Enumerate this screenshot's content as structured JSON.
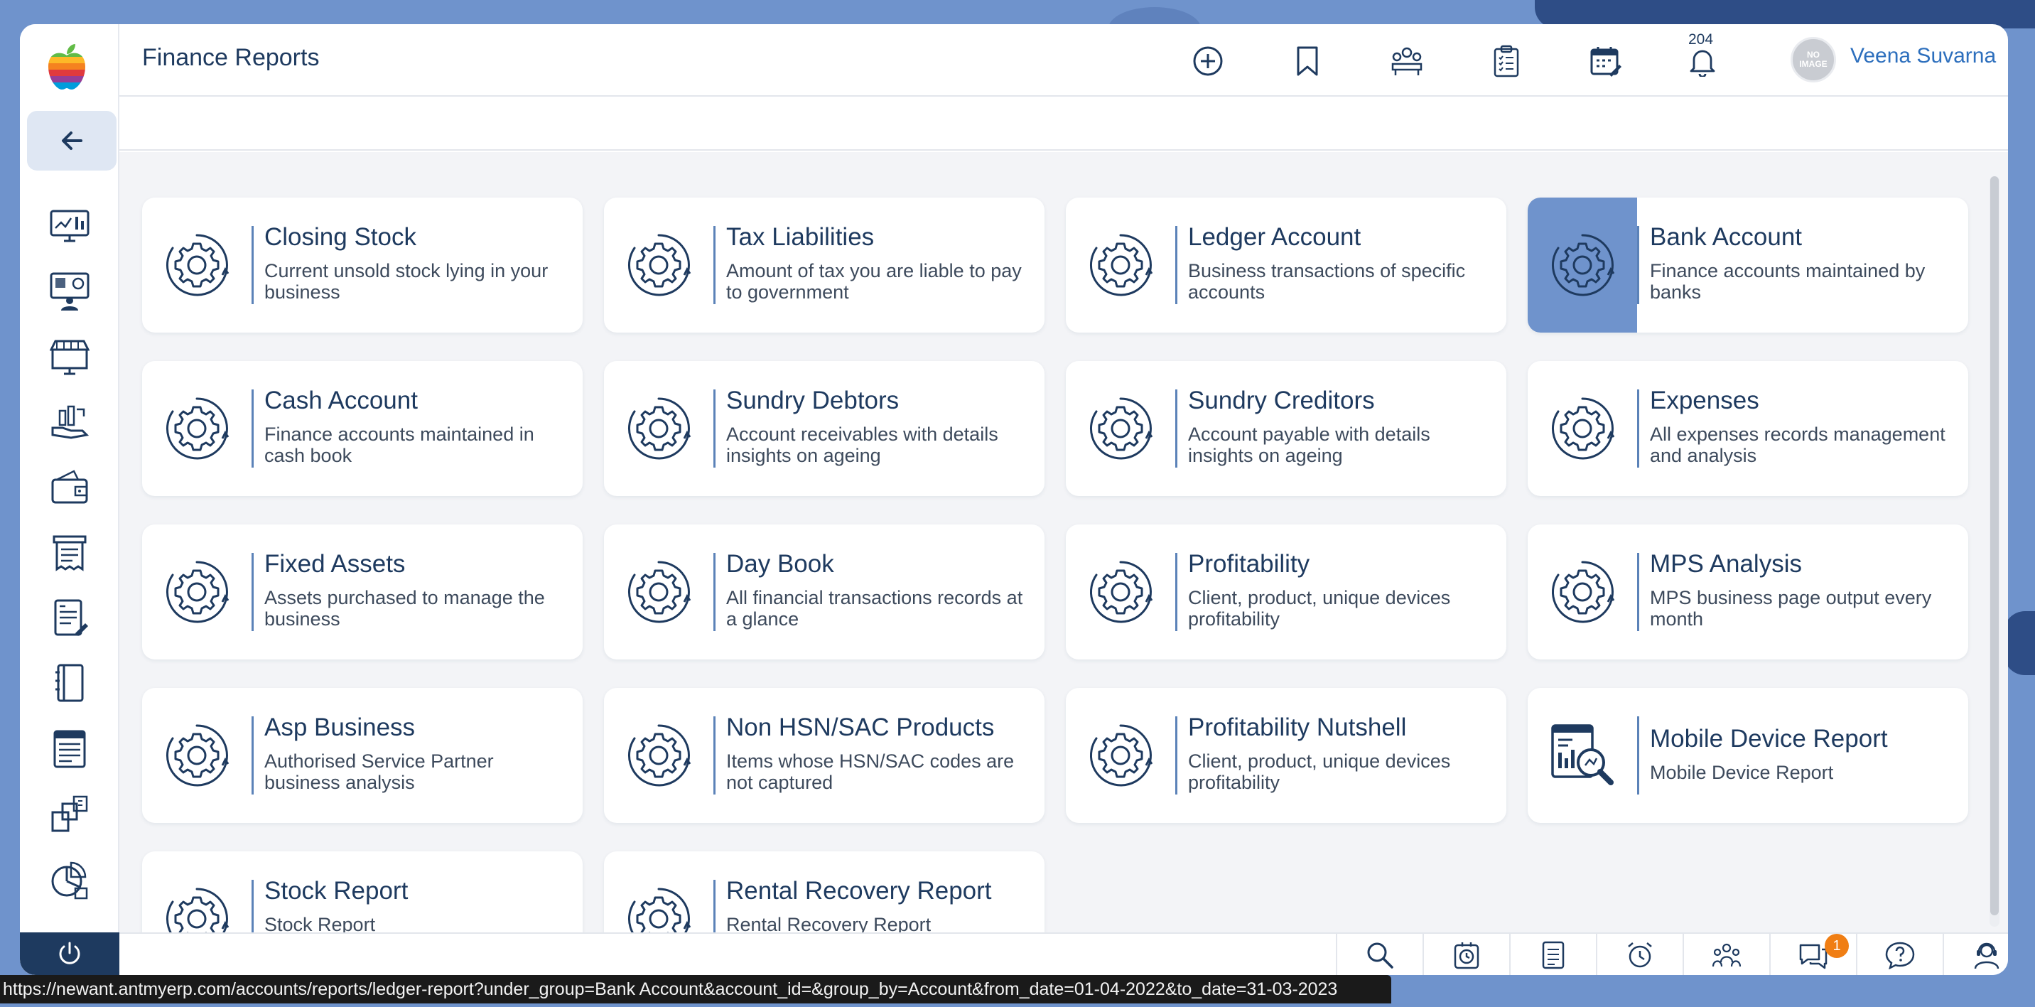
{
  "header": {
    "title": "Finance Reports",
    "notification_count": "204",
    "avatar_text": "NO IMAGE",
    "user_name": "Veena Suvarna"
  },
  "cards": [
    {
      "title": "Closing Stock",
      "desc": "Current unsold stock lying in your business",
      "icon": "gear-icon"
    },
    {
      "title": "Tax Liabilities",
      "desc": "Amount of tax you are liable to pay to government",
      "icon": "gear-icon"
    },
    {
      "title": "Ledger Account",
      "desc": "Business transactions of specific accounts",
      "icon": "gear-icon"
    },
    {
      "title": "Bank Account",
      "desc": "Finance accounts maintained by banks",
      "icon": "gear-icon",
      "active": true
    },
    {
      "title": "Cash Account",
      "desc": "Finance accounts maintained in cash book",
      "icon": "gear-icon"
    },
    {
      "title": "Sundry Debtors",
      "desc": "Account receivables with details insights on ageing",
      "icon": "gear-icon"
    },
    {
      "title": "Sundry Creditors",
      "desc": "Account payable with details insights on ageing",
      "icon": "gear-icon"
    },
    {
      "title": "Expenses",
      "desc": "All expenses records management and analysis",
      "icon": "gear-icon"
    },
    {
      "title": "Fixed Assets",
      "desc": "Assets purchased to manage the business",
      "icon": "gear-icon"
    },
    {
      "title": "Day Book",
      "desc": "All financial transactions records at a glance",
      "icon": "gear-icon"
    },
    {
      "title": "Profitability",
      "desc": "Client, product, unique devices profitability",
      "icon": "gear-icon"
    },
    {
      "title": "MPS Analysis",
      "desc": "MPS business page output every month",
      "icon": "gear-icon"
    },
    {
      "title": "Asp Business",
      "desc": "Authorised Service Partner business analysis",
      "icon": "gear-icon"
    },
    {
      "title": "Non HSN/SAC Products",
      "desc": "Items whose  HSN/SAC codes are not captured",
      "icon": "gear-icon"
    },
    {
      "title": "Profitability Nutshell",
      "desc": "Client, product, unique devices profitability",
      "icon": "gear-icon"
    },
    {
      "title": "Mobile Device Report",
      "desc": "Mobile Device Report",
      "icon": "report-search-icon"
    },
    {
      "title": "Stock Report",
      "desc": "Stock Report",
      "icon": "gear-icon"
    },
    {
      "title": "Rental Recovery Report",
      "desc": "Rental Recovery Report",
      "icon": "gear-icon"
    }
  ],
  "footer": {
    "chat_badge": "1"
  },
  "status_url": "https://newant.antmyerp.com/accounts/reports/ledger-report?under_group=Bank Account&account_id=&group_by=Account&from_date=01-04-2022&to_date=31-03-2023",
  "colors": {
    "primary": "#1e3a5f",
    "accent": "#6f93cc",
    "link": "#2d6fbd",
    "badge": "#f07e14"
  }
}
